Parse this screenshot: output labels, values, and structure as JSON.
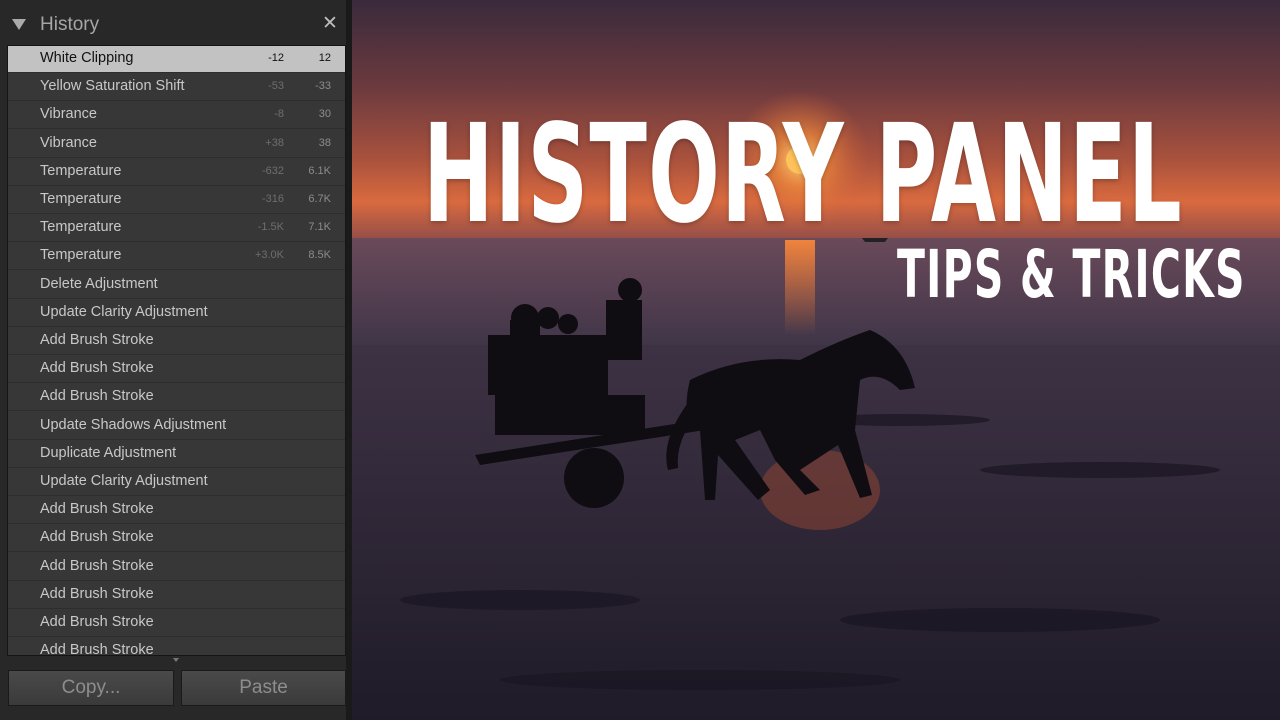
{
  "panel": {
    "title": "History",
    "close_icon": "close-icon",
    "collapse_icon": "triangle-down-icon"
  },
  "history": [
    {
      "label": "White Clipping",
      "from": "-12",
      "to": "12",
      "selected": true
    },
    {
      "label": "Yellow Saturation Shift",
      "from": "-53",
      "to": "-33"
    },
    {
      "label": "Vibrance",
      "from": "-8",
      "to": "30"
    },
    {
      "label": "Vibrance",
      "from": "+38",
      "to": "38"
    },
    {
      "label": "Temperature",
      "from": "-632",
      "to": "6.1K"
    },
    {
      "label": "Temperature",
      "from": "-316",
      "to": "6.7K"
    },
    {
      "label": "Temperature",
      "from": "-1.5K",
      "to": "7.1K"
    },
    {
      "label": "Temperature",
      "from": "+3.0K",
      "to": "8.5K"
    },
    {
      "label": "Delete Adjustment",
      "from": "",
      "to": ""
    },
    {
      "label": "Update Clarity Adjustment",
      "from": "",
      "to": ""
    },
    {
      "label": "Add Brush Stroke",
      "from": "",
      "to": ""
    },
    {
      "label": "Add Brush Stroke",
      "from": "",
      "to": ""
    },
    {
      "label": "Add Brush Stroke",
      "from": "",
      "to": ""
    },
    {
      "label": "Update Shadows Adjustment",
      "from": "",
      "to": ""
    },
    {
      "label": "Duplicate Adjustment",
      "from": "",
      "to": ""
    },
    {
      "label": "Update Clarity Adjustment",
      "from": "",
      "to": ""
    },
    {
      "label": "Add Brush Stroke",
      "from": "",
      "to": ""
    },
    {
      "label": "Add Brush Stroke",
      "from": "",
      "to": ""
    },
    {
      "label": "Add Brush Stroke",
      "from": "",
      "to": ""
    },
    {
      "label": "Add Brush Stroke",
      "from": "",
      "to": ""
    },
    {
      "label": "Add Brush Stroke",
      "from": "",
      "to": ""
    },
    {
      "label": "Add Brush Stroke",
      "from": "",
      "to": ""
    }
  ],
  "buttons": {
    "copy": "Copy...",
    "paste": "Paste"
  },
  "overlay": {
    "title": "HISTORY PANEL",
    "subtitle": "TIPS & TRICKS"
  },
  "colors": {
    "panel_bg": "#282828",
    "list_bg": "#373737",
    "selected_row": "#c2c2c2",
    "sun": "#f0a030"
  }
}
